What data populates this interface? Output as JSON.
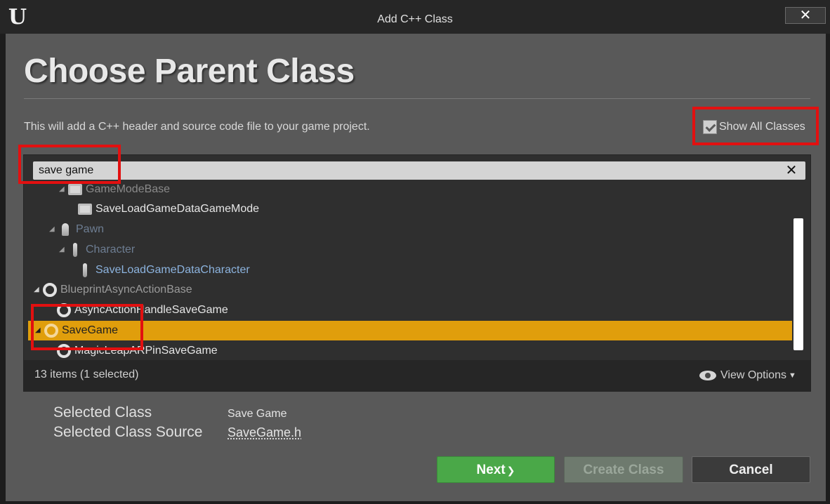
{
  "window": {
    "title": "Add C++ Class",
    "close_label": "✕",
    "logo_text": "U"
  },
  "page": {
    "heading": "Choose Parent Class",
    "description": "This will add a C++ header and source code file to your game project.",
    "show_all_label": "Show All Classes"
  },
  "search": {
    "value": "save game",
    "clear_label": "✕"
  },
  "tree": {
    "rows": [
      {
        "label": "GameModeBase",
        "color": "#8a8a8a",
        "icon": "game-mode-icon"
      },
      {
        "label": "SaveLoadGameDataGameMode",
        "color": "#e6e6e6",
        "icon": "game-mode-icon"
      },
      {
        "label": "Pawn",
        "color": "#6d7d92",
        "icon": "pawn-icon"
      },
      {
        "label": "Character",
        "color": "#6d7d92",
        "icon": "character-icon"
      },
      {
        "label": "SaveLoadGameDataCharacter",
        "color": "#8cb3de",
        "icon": "character-icon"
      },
      {
        "label": "BlueprintAsyncActionBase",
        "color": "#9a9a9a",
        "icon": "object-ring-icon"
      },
      {
        "label": "AsyncActionHandleSaveGame",
        "color": "#e6e6e6",
        "icon": "object-ring-icon"
      },
      {
        "label": "SaveGame",
        "color": "#202020",
        "icon": "object-ring-icon"
      },
      {
        "label": "MagicLeapARPinSaveGame",
        "color": "#e6e6e6",
        "icon": "object-ring-icon"
      }
    ],
    "item_count": "13 items (1 selected)",
    "view_options_label": "View Options"
  },
  "selection": {
    "class_label": "Selected Class",
    "class_value": "Save Game",
    "source_label": "Selected Class Source",
    "source_value": "SaveGame.h"
  },
  "buttons": {
    "next": "Next",
    "create": "Create Class",
    "cancel": "Cancel"
  },
  "colors": {
    "selection": "#e09e0c",
    "next": "#4aa848",
    "highlight": "#e21010"
  }
}
